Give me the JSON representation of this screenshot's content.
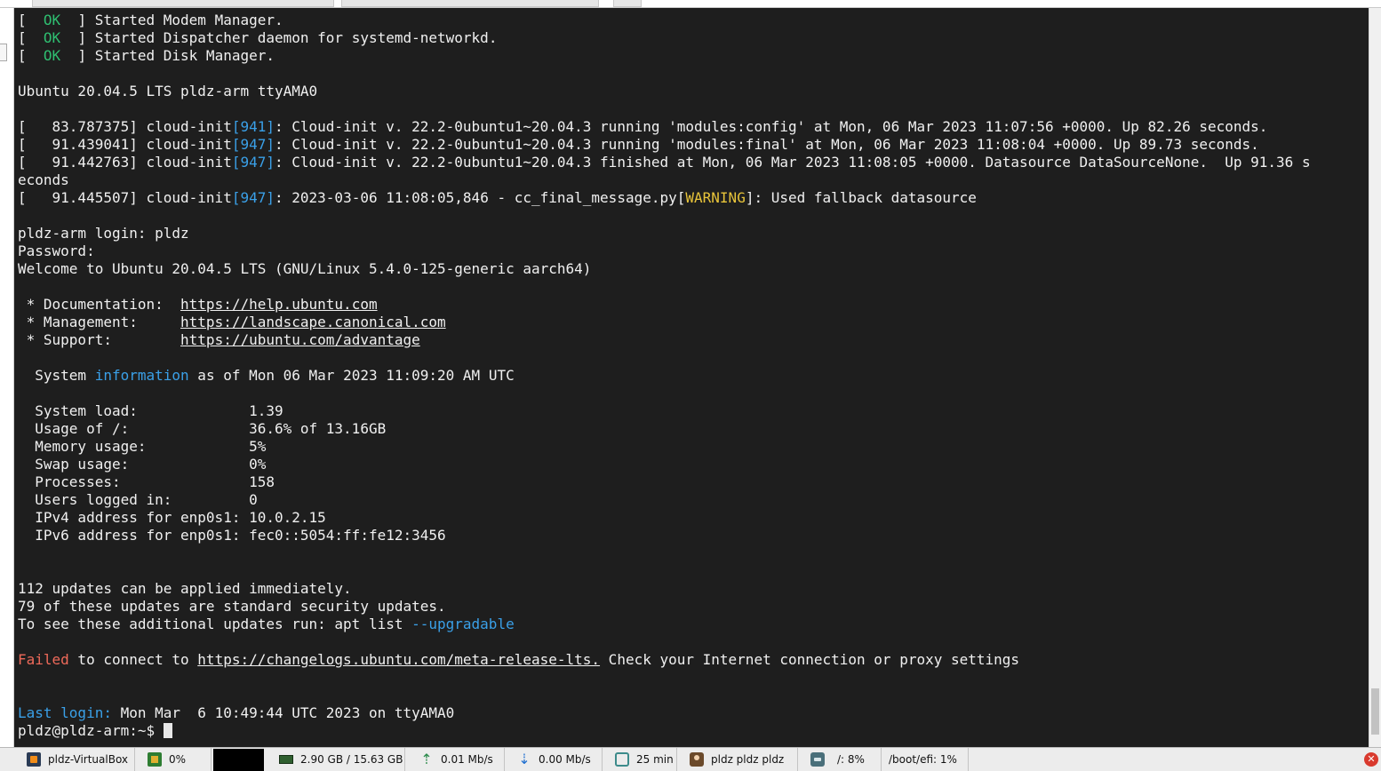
{
  "terminal": {
    "lines": [
      [
        {
          "t": "[  "
        },
        {
          "t": "OK",
          "c": "ok"
        },
        {
          "t": "  ] Started Modem Manager."
        }
      ],
      [
        {
          "t": "[  "
        },
        {
          "t": "OK",
          "c": "ok"
        },
        {
          "t": "  ] Started Dispatcher daemon for systemd-networkd."
        }
      ],
      [
        {
          "t": "[  "
        },
        {
          "t": "OK",
          "c": "ok"
        },
        {
          "t": "  ] Started Disk Manager."
        }
      ],
      [],
      [
        {
          "t": "Ubuntu 20.04.5 LTS pldz-arm ttyAMA0"
        }
      ],
      [],
      [
        {
          "t": "[   83.787375] cloud-init"
        },
        {
          "t": "[941]",
          "c": "blue"
        },
        {
          "t": ": Cloud-init v. 22.2-0ubuntu1~20.04.3 running 'modules:config' at Mon, 06 Mar 2023 11:07:56 +0000. Up 82.26 seconds."
        }
      ],
      [
        {
          "t": "[   91.439041] cloud-init"
        },
        {
          "t": "[947]",
          "c": "blue"
        },
        {
          "t": ": Cloud-init v. 22.2-0ubuntu1~20.04.3 running 'modules:final' at Mon, 06 Mar 2023 11:08:04 +0000. Up 89.73 seconds."
        }
      ],
      [
        {
          "t": "[   91.442763] cloud-init"
        },
        {
          "t": "[947]",
          "c": "blue"
        },
        {
          "t": ": Cloud-init v. 22.2-0ubuntu1~20.04.3 finished at Mon, 06 Mar 2023 11:08:05 +0000. Datasource DataSourceNone.  Up 91.36 s"
        }
      ],
      [
        {
          "t": "econds"
        }
      ],
      [
        {
          "t": "[   91.445507] cloud-init"
        },
        {
          "t": "[947]",
          "c": "blue"
        },
        {
          "t": ": 2023-03-06 11:08:05,846 - cc_final_message.py"
        },
        {
          "t": "[",
          "c": ""
        },
        {
          "t": "WARNING",
          "c": "yellow"
        },
        {
          "t": "]: Used fallback datasource"
        }
      ],
      [],
      [
        {
          "t": "pldz-arm login: pldz"
        }
      ],
      [
        {
          "t": "Password:"
        }
      ],
      [
        {
          "t": "Welcome to Ubuntu 20.04.5 LTS (GNU/Linux 5.4.0-125-generic aarch64)"
        }
      ],
      [],
      [
        {
          "t": " * Documentation:  "
        },
        {
          "t": "https://help.ubuntu.com",
          "c": "link"
        }
      ],
      [
        {
          "t": " * Management:     "
        },
        {
          "t": "https://landscape.canonical.com",
          "c": "link"
        }
      ],
      [
        {
          "t": " * Support:        "
        },
        {
          "t": "https://ubuntu.com/advantage",
          "c": "link"
        }
      ],
      [],
      [
        {
          "t": "  System "
        },
        {
          "t": "information",
          "c": "blue"
        },
        {
          "t": " as of Mon 06 Mar 2023 11:09:20 AM UTC"
        }
      ],
      [],
      [
        {
          "t": "  System load:             1.39"
        }
      ],
      [
        {
          "t": "  Usage of /:              36.6% of 13.16GB"
        }
      ],
      [
        {
          "t": "  Memory usage:            5%"
        }
      ],
      [
        {
          "t": "  Swap usage:              0%"
        }
      ],
      [
        {
          "t": "  Processes:               158"
        }
      ],
      [
        {
          "t": "  Users logged in:         0"
        }
      ],
      [
        {
          "t": "  IPv4 address for enp0s1: 10.0.2.15"
        }
      ],
      [
        {
          "t": "  IPv6 address for enp0s1: fec0::5054:ff:fe12:3456"
        }
      ],
      [],
      [],
      [
        {
          "t": "112 updates can be applied immediately."
        }
      ],
      [
        {
          "t": "79 of these updates are standard security updates."
        }
      ],
      [
        {
          "t": "To see these additional updates run: apt list "
        },
        {
          "t": "--upgradable",
          "c": "blue"
        }
      ],
      [],
      [
        {
          "t": "Failed",
          "c": "red"
        },
        {
          "t": " to connect to "
        },
        {
          "t": "https://changelogs.ubuntu.com/meta-release-lts.",
          "c": "link"
        },
        {
          "t": " Check your Internet connection or proxy settings"
        }
      ],
      [],
      [],
      [
        {
          "t": "Last login:",
          "c": "blue"
        },
        {
          "t": " Mon Mar  6 10:49:44 UTC 2023 on ttyAMA0"
        }
      ],
      [
        {
          "t": "pldz@pldz-arm:~$ "
        }
      ]
    ]
  },
  "taskbar": {
    "vm_name": "pldz-VirtualBox",
    "cpu": "0%",
    "memory": "2.90 GB / 15.63 GB",
    "upload": "0.01 Mb/s",
    "download": "0.00 Mb/s",
    "uptime": "25 min",
    "users": "pldz  pldz  pldz",
    "disk_root": "/: 8%",
    "disk_efi": "/boot/efi: 1%"
  },
  "icons": {
    "vm": "virtualbox-icon",
    "cpu": "cpu-chip-icon",
    "memory": "memory-module-icon",
    "upload": "upload-arrow-icon",
    "download": "download-arrow-icon",
    "uptime": "clock-monitor-icon",
    "users": "user-icon",
    "disk": "disk-drive-icon",
    "close": "close-circle-icon"
  },
  "colors": {
    "terminal_bg": "#1e1e1e",
    "text": "#f0f0f0",
    "ok": "#2fbf71",
    "accent_blue": "#3aa0e8",
    "warning": "#e8c43a",
    "error": "#ef6a5a"
  }
}
